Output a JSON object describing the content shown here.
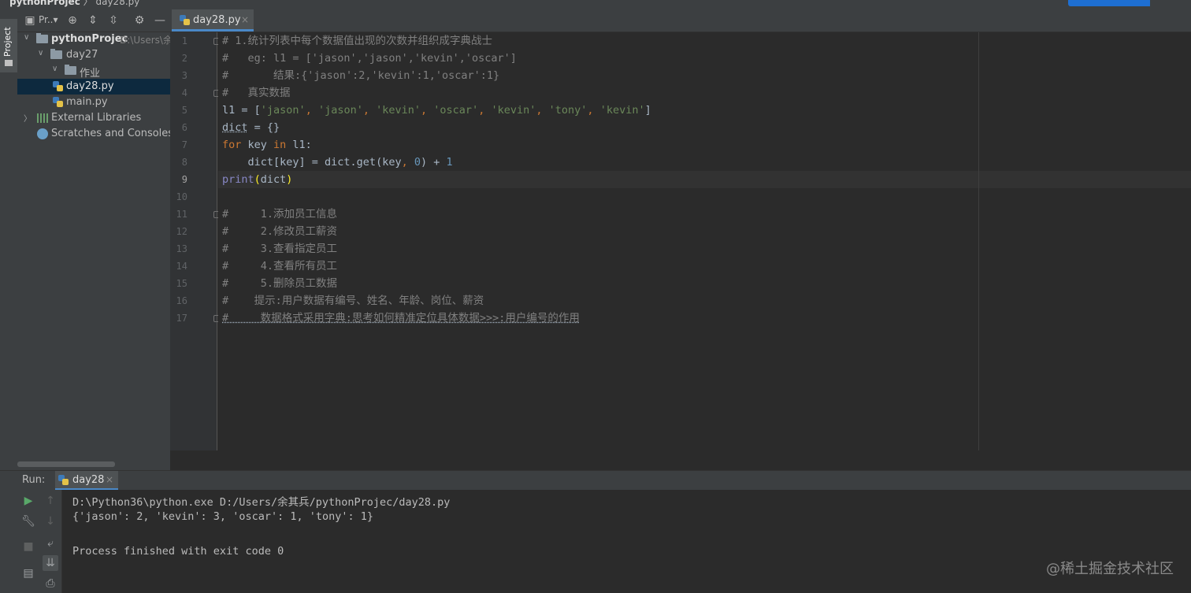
{
  "titlebar": {
    "project": "pythonProjec",
    "separator": "〉",
    "file": "day28.py"
  },
  "tool_stripe": {
    "project_tab": "Project"
  },
  "project_panel": {
    "toolbar_label": "Pr..▾",
    "tree": [
      {
        "label": "pythonProjec",
        "hint": "D:\\Users\\余"
      },
      {
        "label": "day27"
      },
      {
        "label": "作业"
      },
      {
        "label": "day28.py"
      },
      {
        "label": "main.py"
      },
      {
        "label": "External Libraries"
      },
      {
        "label": "Scratches and Consoles"
      }
    ]
  },
  "editor": {
    "tab_label": "day28.py",
    "tab_close": "×",
    "line_numbers": [
      "1",
      "2",
      "3",
      "4",
      "5",
      "6",
      "7",
      "8",
      "9",
      "10",
      "11",
      "12",
      "13",
      "14",
      "15",
      "16",
      "17"
    ],
    "current_line": "9"
  },
  "code": {
    "l1": "# 1.统计列表中每个数据值出现的次数并组织成字典战士",
    "l2": "#   eg: l1 = ['jason','jason','kevin','oscar']",
    "l3": "#       结果:{'jason':2,'kevin':1,'oscar':1}",
    "l4": "#   真实数据",
    "l5_name": "l1",
    "l5_eq": " = [",
    "l5_s1": "'jason'",
    "l5_c": ", ",
    "l5_s2": "'jason'",
    "l5_s3": "'kevin'",
    "l5_s4": "'oscar'",
    "l5_s5": "'kevin'",
    "l5_s6": "'tony'",
    "l5_s7": "'kevin'",
    "l5_end": "]",
    "l6_name": "dict",
    "l6_rest": " = {}",
    "l7_for": "for",
    "l7_key": " key ",
    "l7_in": "in",
    "l7_rest": " l1:",
    "l8_a": "    dict[key] = dict.get(key",
    "l8_comma": ", ",
    "l8_zero": "0",
    "l8_b": ") + ",
    "l8_one": "1",
    "l9_print": "print",
    "l9_open": "(",
    "l9_arg": "dict",
    "l9_close": ")",
    "l11": "#     1.添加员工信息",
    "l12": "#     2.修改员工薪资",
    "l13": "#     3.查看指定员工",
    "l14": "#     4.查看所有员工",
    "l15": "#     5.删除员工数据",
    "l16": "#    提示:用户数据有编号、姓名、年龄、岗位、薪资",
    "l17": "#     数据格式采用字典:思考如何精准定位具体数据>>>:用户编号的作用"
  },
  "run": {
    "label": "Run:",
    "tab_label": "day28",
    "tab_close": "×",
    "console": [
      "D:\\Python36\\python.exe D:/Users/余其兵/pythonProjec/day28.py",
      "{'jason': 2, 'kevin': 3, 'oscar': 1, 'tony': 1}",
      "",
      "Process finished with exit code 0"
    ]
  },
  "watermark": "@稀土掘金技术社区",
  "colors": {
    "accent": "#4a88c7",
    "keyword": "#cc7832",
    "string": "#6a8759",
    "number": "#6897bb",
    "comment": "#808080"
  }
}
